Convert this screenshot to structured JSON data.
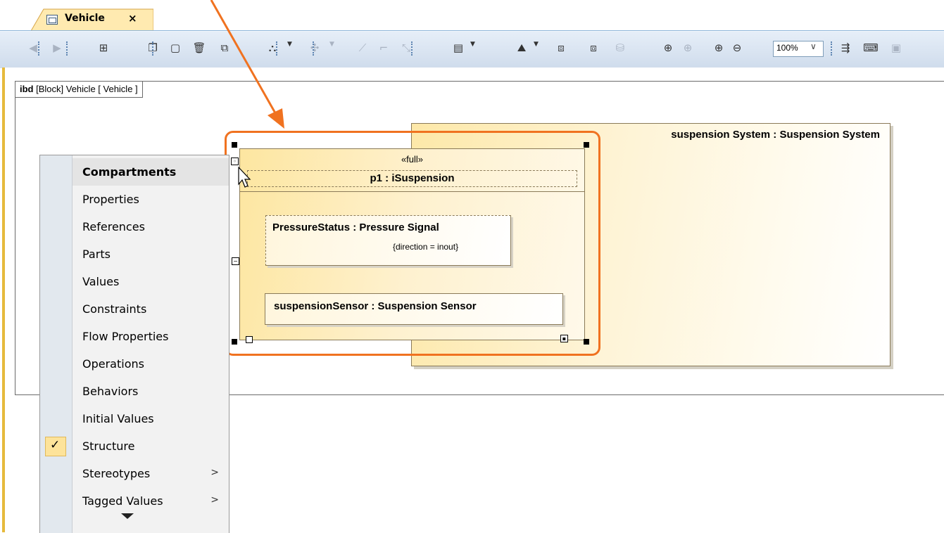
{
  "tab": {
    "label": "Vehicle",
    "close": "×",
    "icon": "diagram-icon"
  },
  "toolbar": {
    "zoom_value": "100%",
    "zoom_arrow": "∨",
    "icons": [
      "back-icon",
      "forward-icon",
      "containment-tree-icon",
      "copy-icon",
      "paste-icon",
      "delete-icon",
      "paste-special-icon",
      "layout-icon",
      "add-port-icon",
      "path-icon",
      "rectilinear-path-icon",
      "oblique-path-icon",
      "frame-icon",
      "fill-color-icon",
      "copy-shape-icon",
      "paste-shape-icon",
      "record-icon",
      "zoom-fit-icon",
      "zoom-selection-icon",
      "zoom-in-icon",
      "zoom-out-icon",
      "hide-labels-icon",
      "keyboard-icon",
      "dock-icon"
    ]
  },
  "diagram": {
    "frame_header_kind": "ibd",
    "frame_header_rest": "[Block] Vehicle [ Vehicle ]",
    "suspension_block_title": "suspension System : Suspension System",
    "port": {
      "stereotype": "«full»",
      "name": "p1 : iSuspension"
    },
    "pressure_part": {
      "name": "PressureStatus : Pressure Signal",
      "constraint": "{direction = inout}"
    },
    "sensor_part": {
      "name": "suspensionSensor : Suspension Sensor"
    },
    "collapse_symbol": "−"
  },
  "menu": {
    "items": [
      {
        "label": "Compartments",
        "header": true
      },
      {
        "label": "Properties"
      },
      {
        "label": "References"
      },
      {
        "label": "Parts"
      },
      {
        "label": "Values"
      },
      {
        "label": "Constraints"
      },
      {
        "label": "Flow Properties"
      },
      {
        "label": "Operations"
      },
      {
        "label": "Behaviors"
      },
      {
        "label": "Initial Values"
      },
      {
        "label": "Structure",
        "checked": true
      },
      {
        "label": "Stereotypes",
        "submenu": true
      },
      {
        "label": "Tagged Values",
        "submenu": true
      }
    ],
    "check_symbol": "✓",
    "submenu_symbol": ">"
  },
  "colors": {
    "callout": "#f07220",
    "block_fill": "#fde8a8",
    "toolbar": "#d6e2f0"
  }
}
